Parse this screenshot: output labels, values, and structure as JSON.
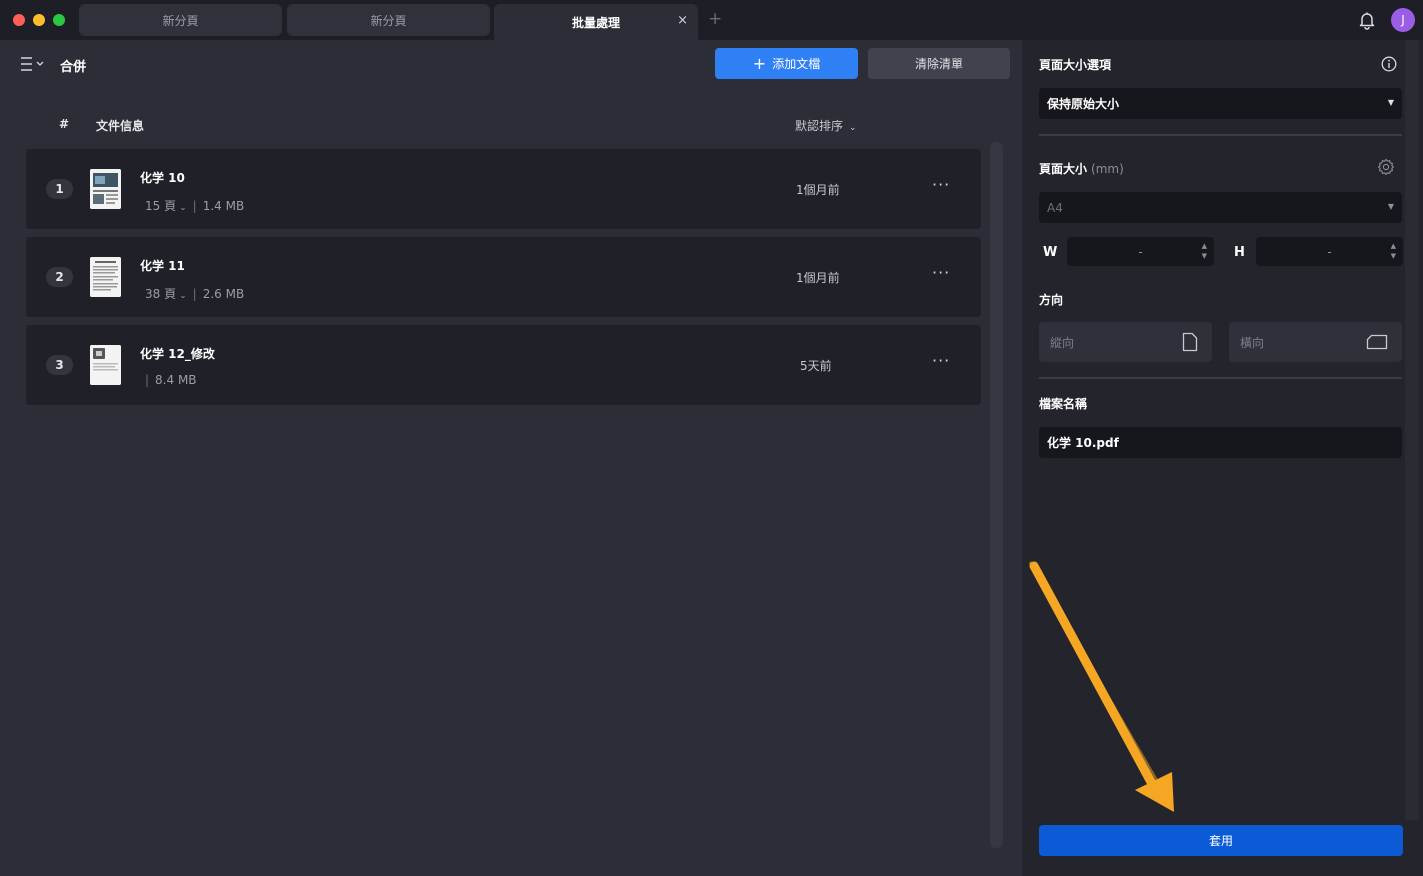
{
  "window": {
    "tabs": [
      {
        "label": "新分頁"
      },
      {
        "label": "新分頁"
      },
      {
        "label": "批量處理",
        "close": "×"
      }
    ],
    "new_tab": "+",
    "avatar_initial": "J"
  },
  "header": {
    "mode_title": "合併",
    "add_button": "添加文檔",
    "add_icon": "+",
    "clear_button": "清除清單"
  },
  "list": {
    "col_number": "#",
    "col_info": "文件信息",
    "sort_label": "默認排序",
    "files": [
      {
        "index": "1",
        "name": "化学 10",
        "pages": "15 頁",
        "size": "1.4 MB",
        "date": "1個月前",
        "more": "···"
      },
      {
        "index": "2",
        "name": "化学 11",
        "pages": "38 頁",
        "size": "2.6 MB",
        "date": "1個月前",
        "more": "···"
      },
      {
        "index": "3",
        "name": "化学 12_修改",
        "pages": "",
        "size": "8.4 MB",
        "date": "5天前",
        "more": "···"
      }
    ]
  },
  "settings": {
    "page_size_options_label": "頁面大小選項",
    "page_size_option_value": "保持原始大小",
    "page_size_label": "頁面大小",
    "page_size_unit": "(mm)",
    "page_size_value": "A4",
    "width_label": "W",
    "width_value": "-",
    "height_label": "H",
    "height_value": "-",
    "orientation_label": "方向",
    "portrait_label": "縱向",
    "landscape_label": "橫向",
    "filename_label": "檔案名稱",
    "filename_value": "化学 10.pdf",
    "apply_button": "套用"
  },
  "colors": {
    "accent": "#2f7ff5",
    "apply": "#0b5bd6",
    "annotation_arrow": "#f5a623"
  }
}
